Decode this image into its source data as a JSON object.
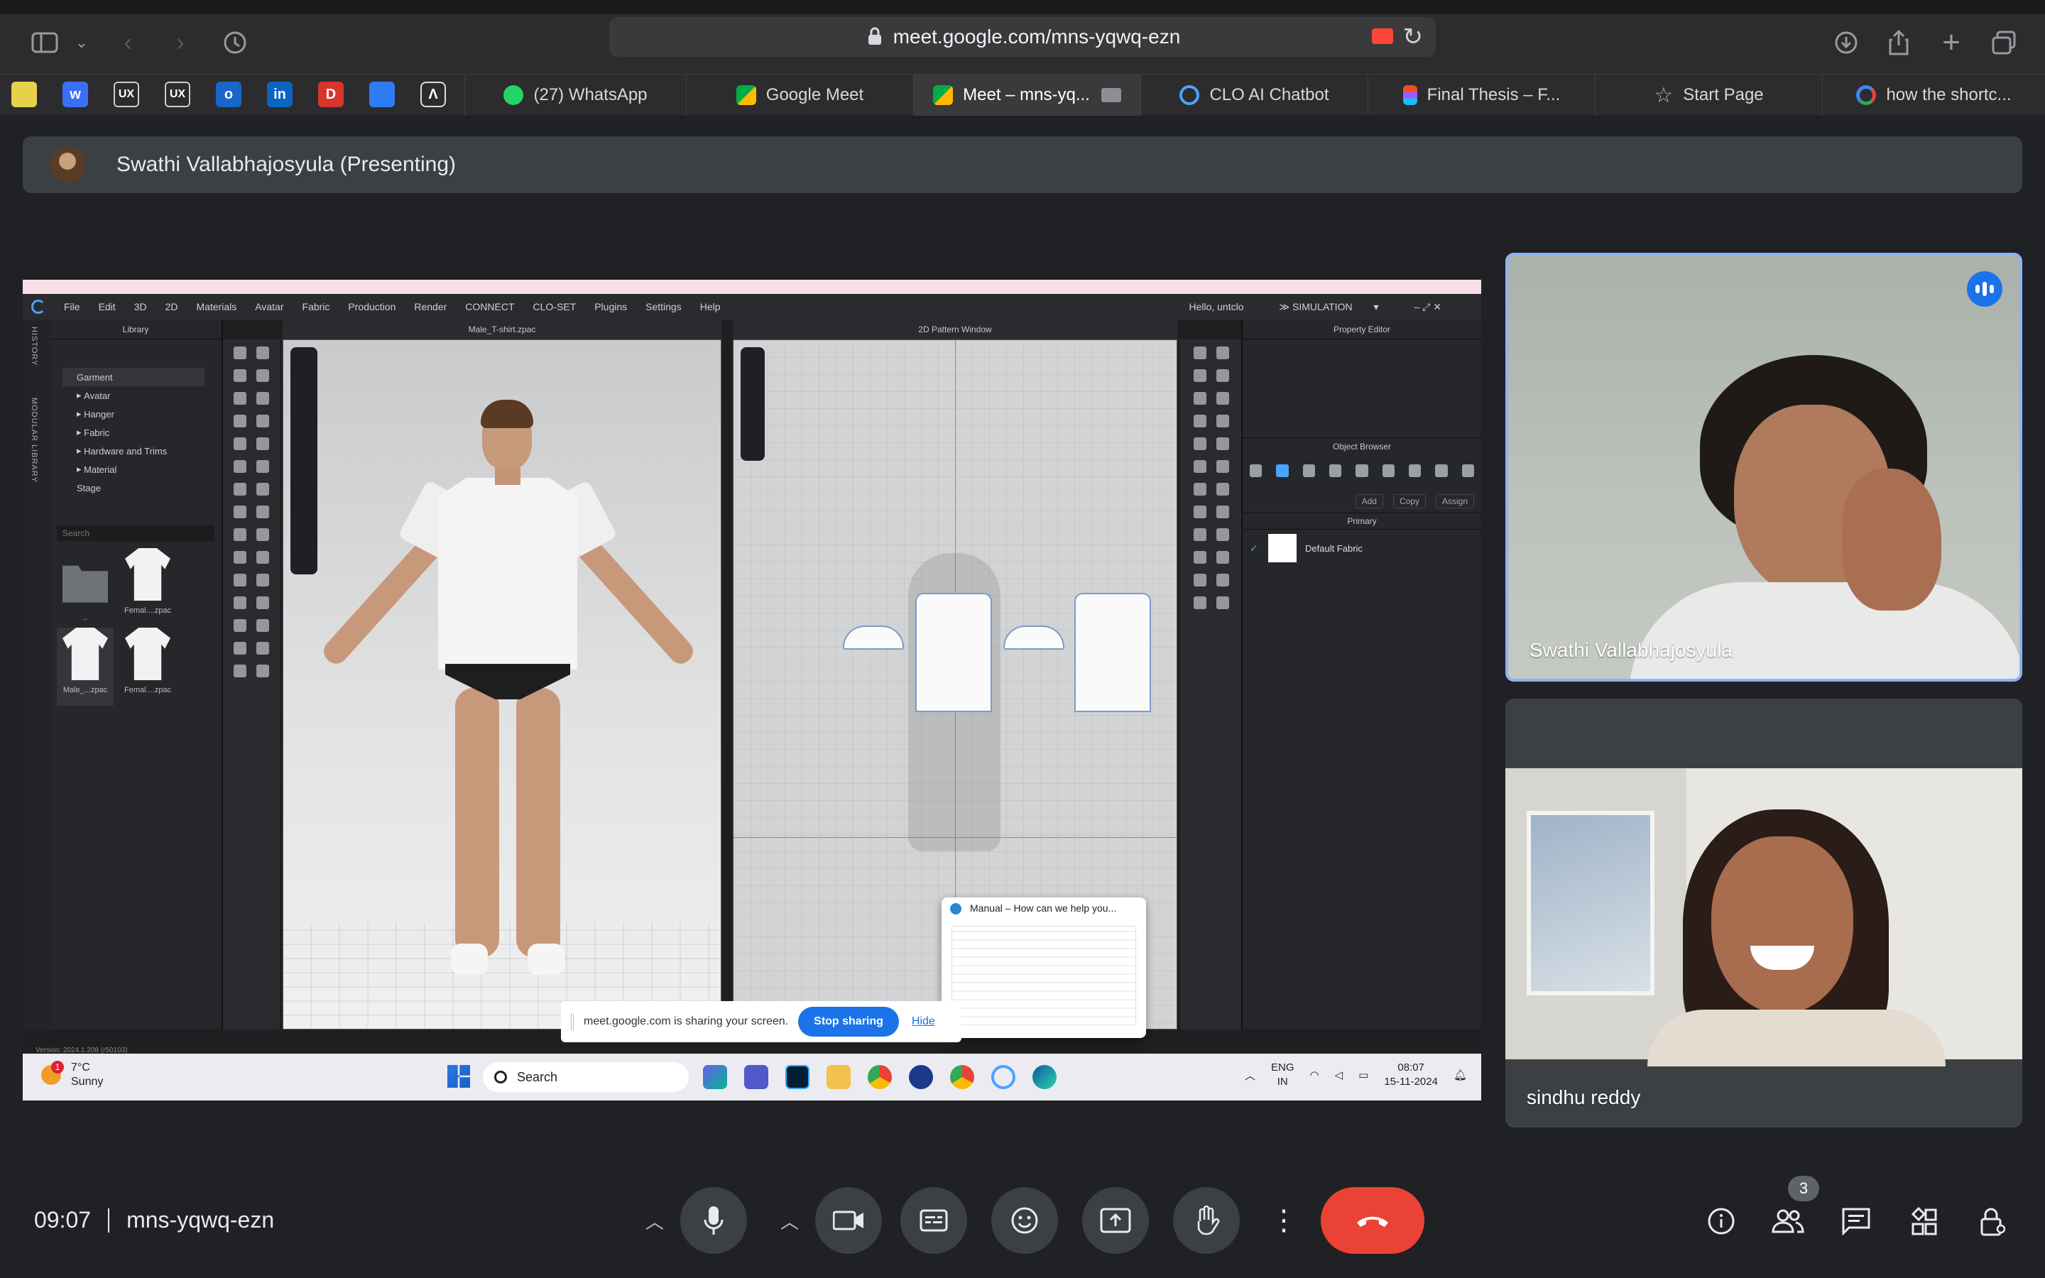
{
  "browser": {
    "url": "meet.google.com/mns-yqwq-ezn",
    "favorites": [
      "UX",
      "UX"
    ],
    "tabs": [
      {
        "label": "(27) WhatsApp",
        "icon": "whatsapp-icon",
        "color": "#25d366"
      },
      {
        "label": "Google Meet",
        "icon": "google-meet-icon",
        "color": "#00ac47"
      },
      {
        "label": "Meet – mns-yq...",
        "icon": "google-meet-icon",
        "color": "#00ac47"
      },
      {
        "label": "CLO AI Chatbot",
        "icon": "clo-icon",
        "color": "#4aa3ff"
      },
      {
        "label": "Final Thesis – F...",
        "icon": "figma-icon",
        "color": "#f24e1e"
      },
      {
        "label": "Start Page",
        "icon": "star-icon",
        "color": "#b0b0b4"
      },
      {
        "label": "how the shortc...",
        "icon": "google-icon",
        "color": "#4285f4"
      }
    ]
  },
  "presenter": {
    "label": "Swathi Vallabhajosyula (Presenting)"
  },
  "clo": {
    "menu": [
      "File",
      "Edit",
      "3D",
      "2D",
      "Materials",
      "Avatar",
      "Fabric",
      "Production",
      "Render",
      "CONNECT",
      "CLO-SET",
      "Plugins",
      "Settings",
      "Help"
    ],
    "greeting": "Hello, untclo",
    "mode": "SIMULATION",
    "left_tabs": [
      "HISTORY",
      "MODULAR LIBRARY"
    ],
    "library_title": "Library",
    "tree": [
      "Garment",
      "Avatar",
      "Hanger",
      "Fabric",
      "Hardware and Trims",
      "Material",
      "Stage"
    ],
    "search_placeholder": "Search",
    "thumbs": [
      "..",
      "Femal....zpac",
      "Male_...zpac",
      "Femal....zpac"
    ],
    "window3d_title": "Male_T-shirt.zpac",
    "window2d_title": "2D Pattern Window",
    "property_editor": "Property Editor",
    "object_browser": "Object Browser",
    "obj_buttons": [
      "Add",
      "Copy",
      "Assign"
    ],
    "primary": "Primary",
    "fabric": "Default Fabric",
    "version": "Version: 2024.1.208 (r50103)"
  },
  "manual_popup": {
    "title": "Manual – How can we help you..."
  },
  "sharing_bar": {
    "text": "meet.google.com is sharing your screen.",
    "stop": "Stop sharing",
    "hide": "Hide"
  },
  "taskbar": {
    "temp": "7°C",
    "weather": "Sunny",
    "weather_badge": "1",
    "search": "Search",
    "lang1": "ENG",
    "lang2": "IN",
    "time": "08:07",
    "date": "15-11-2024"
  },
  "participants": [
    {
      "name": "Swathi Vallabhajosyula"
    },
    {
      "name": "sindhu reddy"
    }
  ],
  "meeting": {
    "time": "09:07",
    "code": "mns-yqwq-ezn",
    "people_count": "3"
  },
  "colors": {
    "meet_bg": "#202124",
    "end_call": "#ea4335",
    "accent": "#1a73e8",
    "speaking_border": "#8ab4f8"
  }
}
